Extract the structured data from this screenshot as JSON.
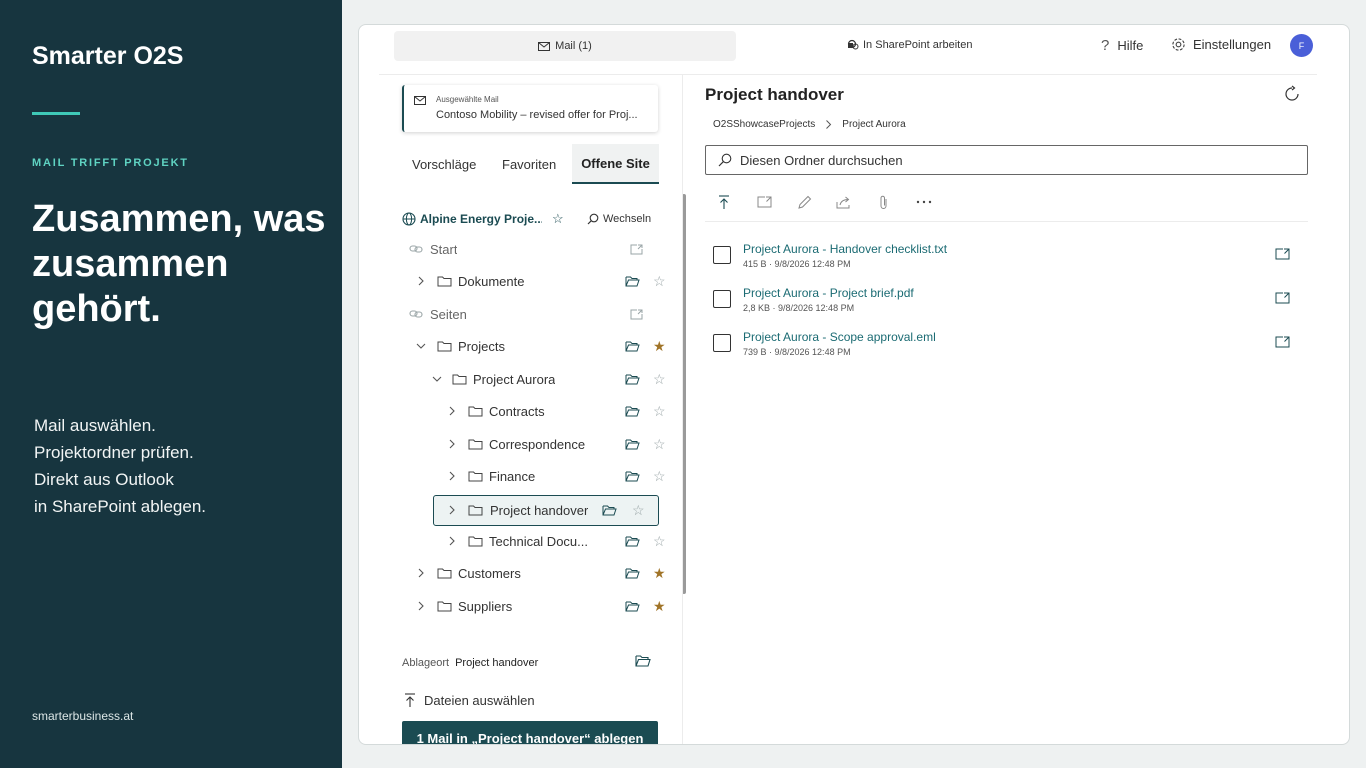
{
  "promo": {
    "brand": "Smarter O2S",
    "kicker": "MAIL TRIFFT PROJEKT",
    "headline": "Zusammen, was zusammen gehört.",
    "body_lines": [
      "Mail auswählen.",
      "Projektordner prüfen.",
      "Direkt aus Outlook",
      "in SharePoint ablegen."
    ],
    "website": "smarterbusiness.at",
    "accent_color": "#3fc9b7",
    "background_color": "#17353f"
  },
  "topbar": {
    "mail_tab_label": "Mail (1)",
    "sharepoint_label": "In SharePoint arbeiten",
    "help_label": "Hilfe",
    "settings_label": "Einstellungen",
    "avatar_initial": "F"
  },
  "selected_mail": {
    "label": "Ausgewählte Mail",
    "subject": "Contoso Mobility – revised offer for Proj..."
  },
  "tabs": [
    "Vorschläge",
    "Favoriten",
    "Offene Site"
  ],
  "site": {
    "name": "Alpine Energy Proje...",
    "switch_label": "Wechseln"
  },
  "tree": [
    {
      "label": "Start",
      "kind": "group"
    },
    {
      "label": "Dokumente",
      "kind": "folder",
      "starred": false
    },
    {
      "label": "Seiten",
      "kind": "group"
    },
    {
      "label": "Projects",
      "kind": "folder",
      "starred": true
    },
    {
      "label": "Project Aurora",
      "kind": "folder",
      "starred": false
    },
    {
      "label": "Contracts",
      "kind": "folder",
      "starred": false
    },
    {
      "label": "Correspondence",
      "kind": "folder",
      "starred": false
    },
    {
      "label": "Finance",
      "kind": "folder",
      "starred": false
    },
    {
      "label": "Project handover",
      "kind": "folder",
      "starred": false,
      "selected": true
    },
    {
      "label": "Technical Docu...",
      "kind": "folder",
      "starred": false
    },
    {
      "label": "Customers",
      "kind": "folder",
      "starred": true
    },
    {
      "label": "Suppliers",
      "kind": "folder",
      "starred": true
    }
  ],
  "destination": {
    "label": "Ablageort",
    "value": "Project handover",
    "pick_files_label": "Dateien auswählen",
    "drop_button_label": "1 Mail in „Project handover“ ablegen"
  },
  "folder": {
    "title": "Project handover",
    "breadcrumb": [
      "O2SShowcaseProjects",
      "Project Aurora"
    ],
    "search_placeholder": "Diesen Ordner durchsuchen",
    "files": [
      {
        "name": "Project Aurora - Handover checklist.txt",
        "meta": "415 B · 9/8/2026 12:48 PM"
      },
      {
        "name": "Project Aurora - Project brief.pdf",
        "meta": "2,8 KB · 9/8/2026 12:48 PM"
      },
      {
        "name": "Project Aurora - Scope approval.eml",
        "meta": "739 B · 9/8/2026 12:48 PM"
      }
    ]
  },
  "colors": {
    "primary": "#1b4b52",
    "star_active": "#a07428",
    "avatar": "#4a5fd8",
    "link": "#1b6b73"
  }
}
